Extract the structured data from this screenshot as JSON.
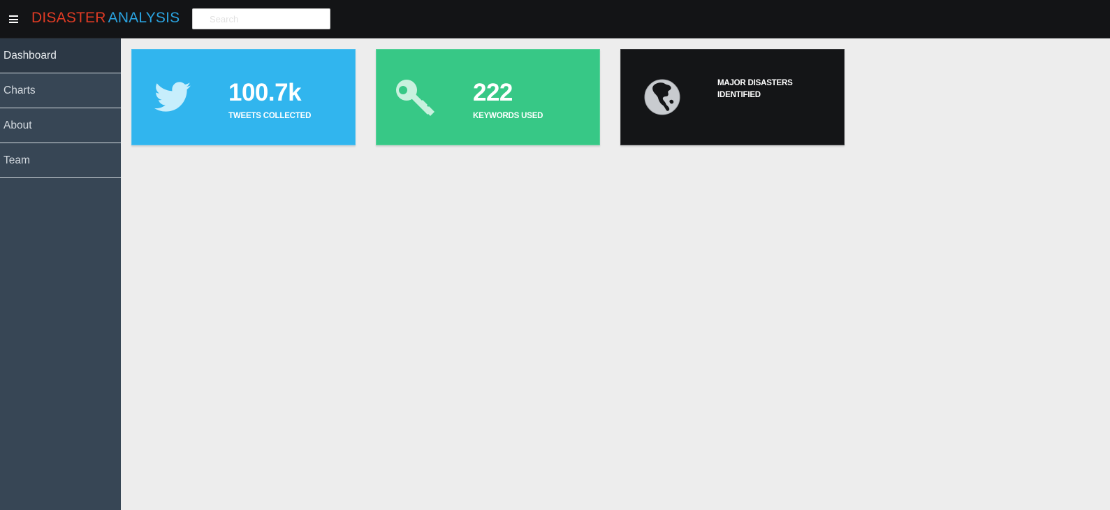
{
  "header": {
    "brand_part1": "DISASTER",
    "brand_part2": "ANALYSIS",
    "search_placeholder": "Search"
  },
  "sidebar": {
    "items": [
      {
        "label": "Dashboard",
        "active": true
      },
      {
        "label": "Charts",
        "active": false
      },
      {
        "label": "About",
        "active": false
      },
      {
        "label": "Team",
        "active": false
      }
    ]
  },
  "cards": [
    {
      "value": "100.7k",
      "label": "TWEETS COLLECTED",
      "icon": "twitter-bird-icon",
      "color": "#31b5ee"
    },
    {
      "value": "222",
      "label": "KEYWORDS USED",
      "icon": "key-icon",
      "color": "#37c886"
    },
    {
      "value": "",
      "label": "MAJOR DISASTERS IDENTIFIED",
      "icon": "globe-icon",
      "color": "#141517"
    }
  ],
  "colors": {
    "brand_red": "#e03b24",
    "brand_blue": "#2aa3e0",
    "topbar": "#131416",
    "sidebar": "#374655"
  }
}
